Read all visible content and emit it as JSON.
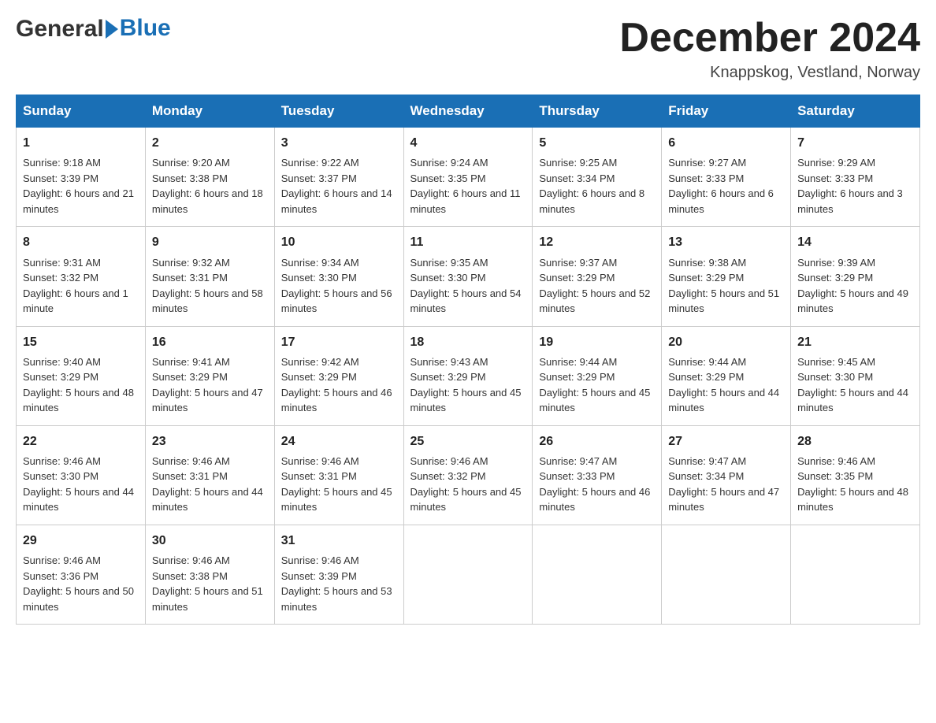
{
  "header": {
    "month_title": "December 2024",
    "location": "Knappskog, Vestland, Norway",
    "logo_general": "General",
    "logo_blue": "Blue"
  },
  "weekdays": [
    "Sunday",
    "Monday",
    "Tuesday",
    "Wednesday",
    "Thursday",
    "Friday",
    "Saturday"
  ],
  "weeks": [
    [
      {
        "day": "1",
        "sunrise": "9:18 AM",
        "sunset": "3:39 PM",
        "daylight": "6 hours and 21 minutes."
      },
      {
        "day": "2",
        "sunrise": "9:20 AM",
        "sunset": "3:38 PM",
        "daylight": "6 hours and 18 minutes."
      },
      {
        "day": "3",
        "sunrise": "9:22 AM",
        "sunset": "3:37 PM",
        "daylight": "6 hours and 14 minutes."
      },
      {
        "day": "4",
        "sunrise": "9:24 AM",
        "sunset": "3:35 PM",
        "daylight": "6 hours and 11 minutes."
      },
      {
        "day": "5",
        "sunrise": "9:25 AM",
        "sunset": "3:34 PM",
        "daylight": "6 hours and 8 minutes."
      },
      {
        "day": "6",
        "sunrise": "9:27 AM",
        "sunset": "3:33 PM",
        "daylight": "6 hours and 6 minutes."
      },
      {
        "day": "7",
        "sunrise": "9:29 AM",
        "sunset": "3:33 PM",
        "daylight": "6 hours and 3 minutes."
      }
    ],
    [
      {
        "day": "8",
        "sunrise": "9:31 AM",
        "sunset": "3:32 PM",
        "daylight": "6 hours and 1 minute."
      },
      {
        "day": "9",
        "sunrise": "9:32 AM",
        "sunset": "3:31 PM",
        "daylight": "5 hours and 58 minutes."
      },
      {
        "day": "10",
        "sunrise": "9:34 AM",
        "sunset": "3:30 PM",
        "daylight": "5 hours and 56 minutes."
      },
      {
        "day": "11",
        "sunrise": "9:35 AM",
        "sunset": "3:30 PM",
        "daylight": "5 hours and 54 minutes."
      },
      {
        "day": "12",
        "sunrise": "9:37 AM",
        "sunset": "3:29 PM",
        "daylight": "5 hours and 52 minutes."
      },
      {
        "day": "13",
        "sunrise": "9:38 AM",
        "sunset": "3:29 PM",
        "daylight": "5 hours and 51 minutes."
      },
      {
        "day": "14",
        "sunrise": "9:39 AM",
        "sunset": "3:29 PM",
        "daylight": "5 hours and 49 minutes."
      }
    ],
    [
      {
        "day": "15",
        "sunrise": "9:40 AM",
        "sunset": "3:29 PM",
        "daylight": "5 hours and 48 minutes."
      },
      {
        "day": "16",
        "sunrise": "9:41 AM",
        "sunset": "3:29 PM",
        "daylight": "5 hours and 47 minutes."
      },
      {
        "day": "17",
        "sunrise": "9:42 AM",
        "sunset": "3:29 PM",
        "daylight": "5 hours and 46 minutes."
      },
      {
        "day": "18",
        "sunrise": "9:43 AM",
        "sunset": "3:29 PM",
        "daylight": "5 hours and 45 minutes."
      },
      {
        "day": "19",
        "sunrise": "9:44 AM",
        "sunset": "3:29 PM",
        "daylight": "5 hours and 45 minutes."
      },
      {
        "day": "20",
        "sunrise": "9:44 AM",
        "sunset": "3:29 PM",
        "daylight": "5 hours and 44 minutes."
      },
      {
        "day": "21",
        "sunrise": "9:45 AM",
        "sunset": "3:30 PM",
        "daylight": "5 hours and 44 minutes."
      }
    ],
    [
      {
        "day": "22",
        "sunrise": "9:46 AM",
        "sunset": "3:30 PM",
        "daylight": "5 hours and 44 minutes."
      },
      {
        "day": "23",
        "sunrise": "9:46 AM",
        "sunset": "3:31 PM",
        "daylight": "5 hours and 44 minutes."
      },
      {
        "day": "24",
        "sunrise": "9:46 AM",
        "sunset": "3:31 PM",
        "daylight": "5 hours and 45 minutes."
      },
      {
        "day": "25",
        "sunrise": "9:46 AM",
        "sunset": "3:32 PM",
        "daylight": "5 hours and 45 minutes."
      },
      {
        "day": "26",
        "sunrise": "9:47 AM",
        "sunset": "3:33 PM",
        "daylight": "5 hours and 46 minutes."
      },
      {
        "day": "27",
        "sunrise": "9:47 AM",
        "sunset": "3:34 PM",
        "daylight": "5 hours and 47 minutes."
      },
      {
        "day": "28",
        "sunrise": "9:46 AM",
        "sunset": "3:35 PM",
        "daylight": "5 hours and 48 minutes."
      }
    ],
    [
      {
        "day": "29",
        "sunrise": "9:46 AM",
        "sunset": "3:36 PM",
        "daylight": "5 hours and 50 minutes."
      },
      {
        "day": "30",
        "sunrise": "9:46 AM",
        "sunset": "3:38 PM",
        "daylight": "5 hours and 51 minutes."
      },
      {
        "day": "31",
        "sunrise": "9:46 AM",
        "sunset": "3:39 PM",
        "daylight": "5 hours and 53 minutes."
      },
      null,
      null,
      null,
      null
    ]
  ],
  "labels": {
    "sunrise": "Sunrise:",
    "sunset": "Sunset:",
    "daylight": "Daylight:"
  }
}
